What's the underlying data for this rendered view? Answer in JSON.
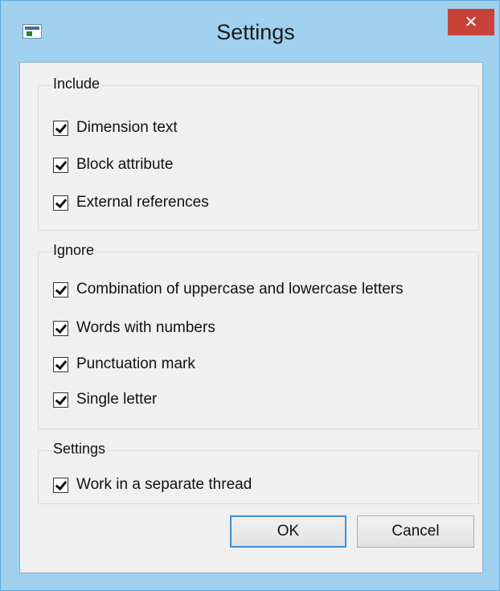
{
  "window": {
    "title": "Settings",
    "close_glyph": "✕",
    "icon": "app-window-icon"
  },
  "groups": {
    "include": {
      "label": "Include",
      "items": [
        {
          "label": "Dimension text",
          "checked": true
        },
        {
          "label": "Block attribute",
          "checked": true
        },
        {
          "label": "External references",
          "checked": true
        }
      ]
    },
    "ignore": {
      "label": "Ignore",
      "items": [
        {
          "label": "Combination of uppercase and lowercase letters",
          "checked": true
        },
        {
          "label": "Words with numbers",
          "checked": true
        },
        {
          "label": "Punctuation mark",
          "checked": true
        },
        {
          "label": "Single letter",
          "checked": true
        }
      ]
    },
    "settings": {
      "label": "Settings",
      "items": [
        {
          "label": "Work in a separate thread",
          "checked": true
        }
      ]
    }
  },
  "buttons": {
    "ok": "OK",
    "cancel": "Cancel"
  },
  "colors": {
    "frame": "#9fd0ee",
    "close": "#c7433a",
    "default_button_border": "#3c8fd4"
  }
}
